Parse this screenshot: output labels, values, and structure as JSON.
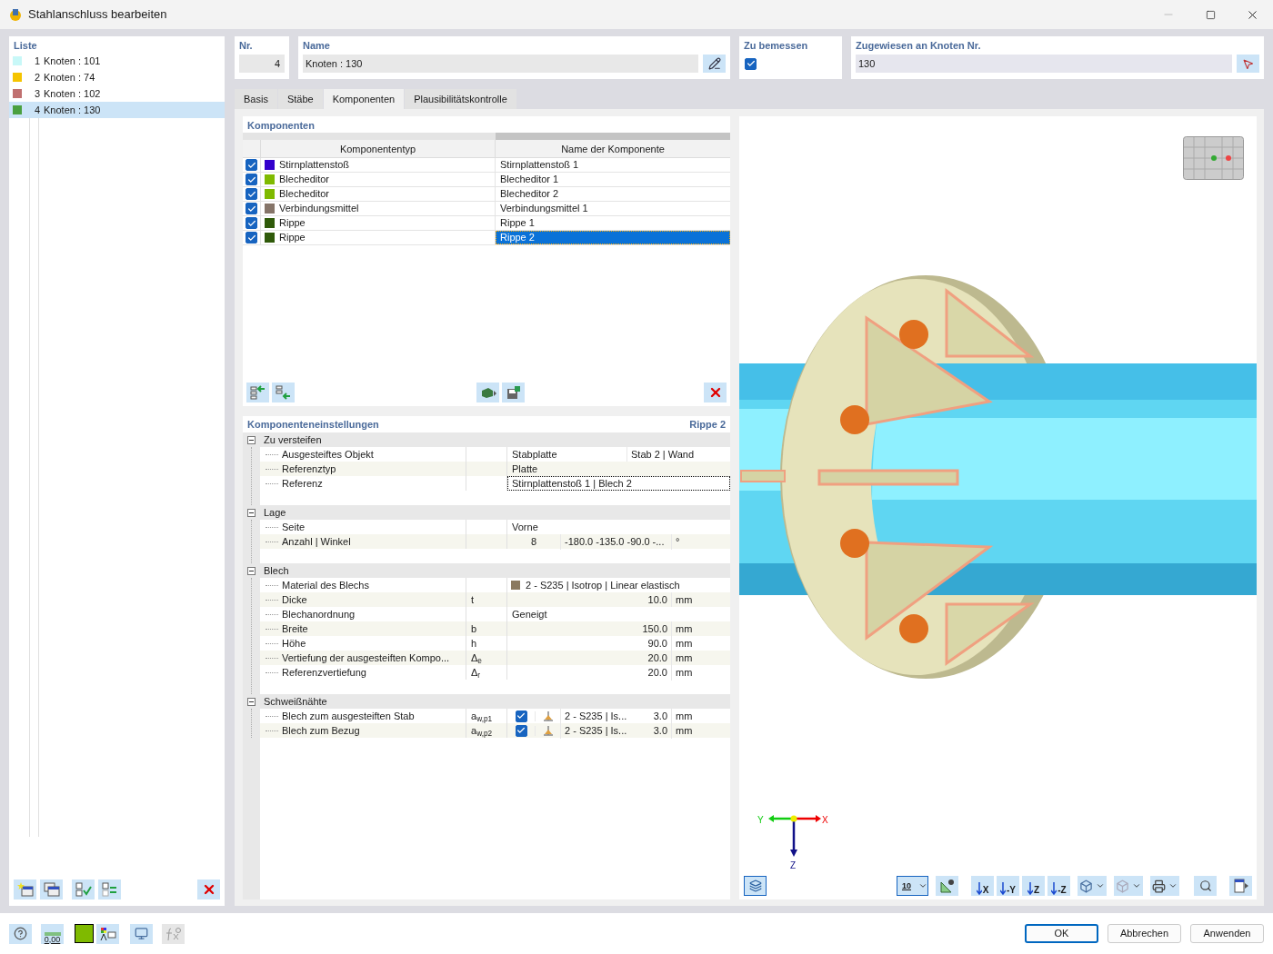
{
  "window": {
    "title": "Stahlanschluss bearbeiten"
  },
  "list": {
    "title": "Liste",
    "items": [
      {
        "number": "1",
        "label": "Knoten : 101",
        "color": "#c8f8f8",
        "selected": false
      },
      {
        "number": "2",
        "label": "Knoten : 74",
        "color": "#f5c400",
        "selected": false
      },
      {
        "number": "3",
        "label": "Knoten : 102",
        "color": "#c07070",
        "selected": false
      },
      {
        "number": "4",
        "label": "Knoten : 130",
        "color": "#4aa040",
        "selected": true
      }
    ]
  },
  "header": {
    "nr": {
      "label": "Nr.",
      "value": "4"
    },
    "name": {
      "label": "Name",
      "value": "Knoten : 130"
    },
    "design": {
      "label": "Zu bemessen",
      "checked": true
    },
    "assigned": {
      "label": "Zugewiesen an Knoten Nr.",
      "value": "130"
    }
  },
  "tabs": [
    {
      "label": "Basis",
      "selected": false
    },
    {
      "label": "Stäbe",
      "selected": false
    },
    {
      "label": "Komponenten",
      "selected": true
    },
    {
      "label": "Plausibilitätskontrolle",
      "selected": false
    }
  ],
  "components": {
    "title": "Komponenten",
    "columns": [
      "Komponententyp",
      "Name der Komponente"
    ],
    "rows": [
      {
        "checked": true,
        "color": "#3300cc",
        "type": "Stirnplattenstoß",
        "name": "Stirnplattenstoß 1",
        "selected": false
      },
      {
        "checked": true,
        "color": "#7fba00",
        "type": "Blecheditor",
        "name": "Blecheditor 1",
        "selected": false
      },
      {
        "checked": true,
        "color": "#7fba00",
        "type": "Blecheditor",
        "name": "Blecheditor 2",
        "selected": false
      },
      {
        "checked": true,
        "color": "#857468",
        "type": "Verbindungsmittel",
        "name": "Verbindungsmittel 1",
        "selected": false
      },
      {
        "checked": true,
        "color": "#2f5a0a",
        "type": "Rippe",
        "name": "Rippe 1",
        "selected": false
      },
      {
        "checked": true,
        "color": "#2f5a0a",
        "type": "Rippe",
        "name": "Rippe 2",
        "selected": true
      }
    ]
  },
  "settings": {
    "title": "Komponenteneinstellungen",
    "current": "Rippe 2",
    "groups": [
      {
        "title": "Zu versteifen",
        "expanded": true,
        "rows": [
          {
            "kind": "text",
            "label": "Ausgesteiftes Objekt",
            "value": "Stabplatte",
            "extra": "Stab 2 | Wand"
          },
          {
            "kind": "text",
            "label": "Referenztyp",
            "value": "Platte"
          },
          {
            "kind": "text",
            "label": "Referenz",
            "value": "Stirnplattenstoß 1 | Blech 2",
            "focused": true
          }
        ]
      },
      {
        "title": "Lage",
        "expanded": true,
        "rows": [
          {
            "kind": "text",
            "label": "Seite",
            "value": "Vorne"
          },
          {
            "kind": "count",
            "label": "Anzahl | Winkel",
            "count": "8",
            "angles": "-180.0 -135.0 -90.0 -...",
            "unit": "°"
          }
        ]
      },
      {
        "title": "Blech",
        "expanded": true,
        "rows": [
          {
            "kind": "material",
            "label": "Material des Blechs",
            "color": "#8a7a60",
            "value": "2 - S235 | Isotrop | Linear elastisch"
          },
          {
            "kind": "number",
            "label": "Dicke",
            "symbol": "t",
            "value": "10.0",
            "unit": "mm"
          },
          {
            "kind": "text",
            "label": "Blechanordnung",
            "value": "Geneigt"
          },
          {
            "kind": "number",
            "label": "Breite",
            "symbol": "b",
            "value": "150.0",
            "unit": "mm"
          },
          {
            "kind": "number",
            "label": "Höhe",
            "symbol": "h",
            "value": "90.0",
            "unit": "mm"
          },
          {
            "kind": "number",
            "label": "Vertiefung der ausgesteiften Kompo...",
            "symbol": "Δ$_{e}$",
            "value": "20.0",
            "unit": "mm"
          },
          {
            "kind": "number",
            "label": "Referenzvertiefung",
            "symbol": "Δ$_{r}$",
            "value": "20.0",
            "unit": "mm"
          }
        ]
      },
      {
        "title": "Schweißnähte",
        "expanded": true,
        "rows": [
          {
            "kind": "weld",
            "label": "Blech zum ausgesteiften Stab",
            "symbol": "a$_{w,p1}$",
            "checked": true,
            "material": "2 - S235 | Is...",
            "value": "3.0",
            "unit": "mm"
          },
          {
            "kind": "weld",
            "label": "Blech zum Bezug",
            "symbol": "a$_{w,p2}$",
            "checked": true,
            "material": "2 - S235 | Is...",
            "value": "3.0",
            "unit": "mm"
          }
        ]
      }
    ]
  },
  "view": {
    "axes": {
      "x": "X",
      "y": "Y",
      "z": "Z"
    },
    "scale_label": "10",
    "view_buttons": [
      "X",
      "-Y",
      "Z",
      "-Z"
    ]
  },
  "bottom_bar": {
    "decimal_label": "0,00",
    "buttons": [
      {
        "label": "OK",
        "default": true
      },
      {
        "label": "Abbrechen",
        "default": false
      },
      {
        "label": "Anwenden",
        "default": false
      }
    ]
  }
}
